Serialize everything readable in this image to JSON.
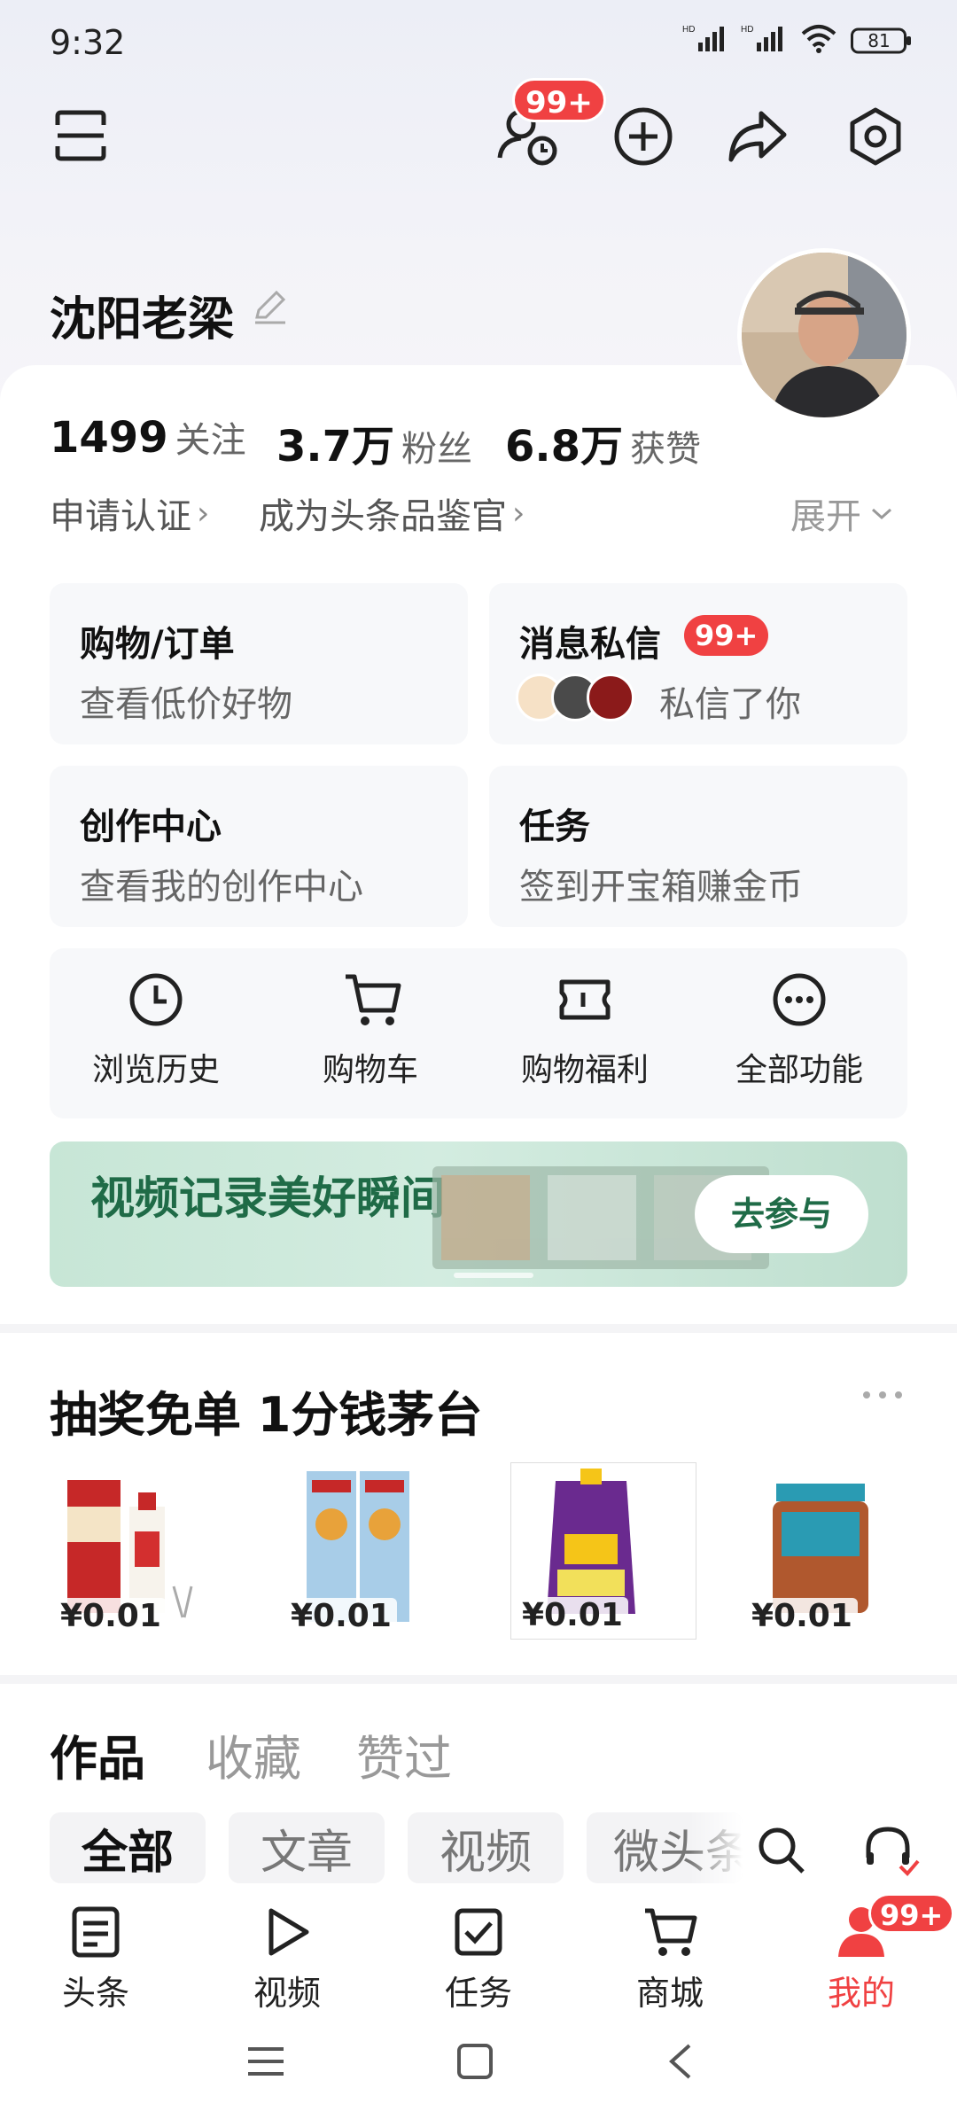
{
  "status_bar": {
    "time": "9:32",
    "battery": "81"
  },
  "header": {
    "notify_badge": "99+"
  },
  "profile": {
    "name": "沈阳老梁"
  },
  "stats": [
    {
      "value": "1499",
      "label": "关注"
    },
    {
      "value": "3.7万",
      "label": "粉丝"
    },
    {
      "value": "6.8万",
      "label": "获赞"
    }
  ],
  "links": {
    "certify": "申请认证",
    "judge": "成为头条品鉴官",
    "expand": "展开"
  },
  "tiles": {
    "shop": {
      "title": "购物/订单",
      "sub": "查看低价好物"
    },
    "messages": {
      "title": "消息私信",
      "badge": "99+",
      "sub": "私信了你"
    },
    "creator": {
      "title": "创作中心",
      "sub": "查看我的创作中心"
    },
    "tasks": {
      "title": "任务",
      "sub": "签到开宝箱赚金币"
    }
  },
  "functions": [
    {
      "label": "浏览历史",
      "icon": "clock-icon"
    },
    {
      "label": "购物车",
      "icon": "cart-icon"
    },
    {
      "label": "购物福利",
      "icon": "ticket-icon"
    },
    {
      "label": "全部功能",
      "icon": "more-icon"
    }
  ],
  "banner": {
    "text": "视频记录美好瞬间",
    "button": "去参与"
  },
  "promo": {
    "title": "抽奖免单 1分钱茅台",
    "products": [
      {
        "price": "¥0.01"
      },
      {
        "price": "¥0.01"
      },
      {
        "price": "¥0.01"
      },
      {
        "price": "¥0.01"
      }
    ]
  },
  "content_tabs": [
    "作品",
    "收藏",
    "赞过"
  ],
  "filter_chips": [
    "全部",
    "文章",
    "视频",
    "微头条"
  ],
  "bottom_nav": {
    "items": [
      {
        "label": "头条"
      },
      {
        "label": "视频"
      },
      {
        "label": "任务"
      },
      {
        "label": "商城"
      },
      {
        "label": "我的"
      }
    ],
    "me_badge": "99+"
  },
  "colors": {
    "accent": "#f04142",
    "banner_bg": "#cbe8d9",
    "banner_text": "#1f6b47"
  }
}
